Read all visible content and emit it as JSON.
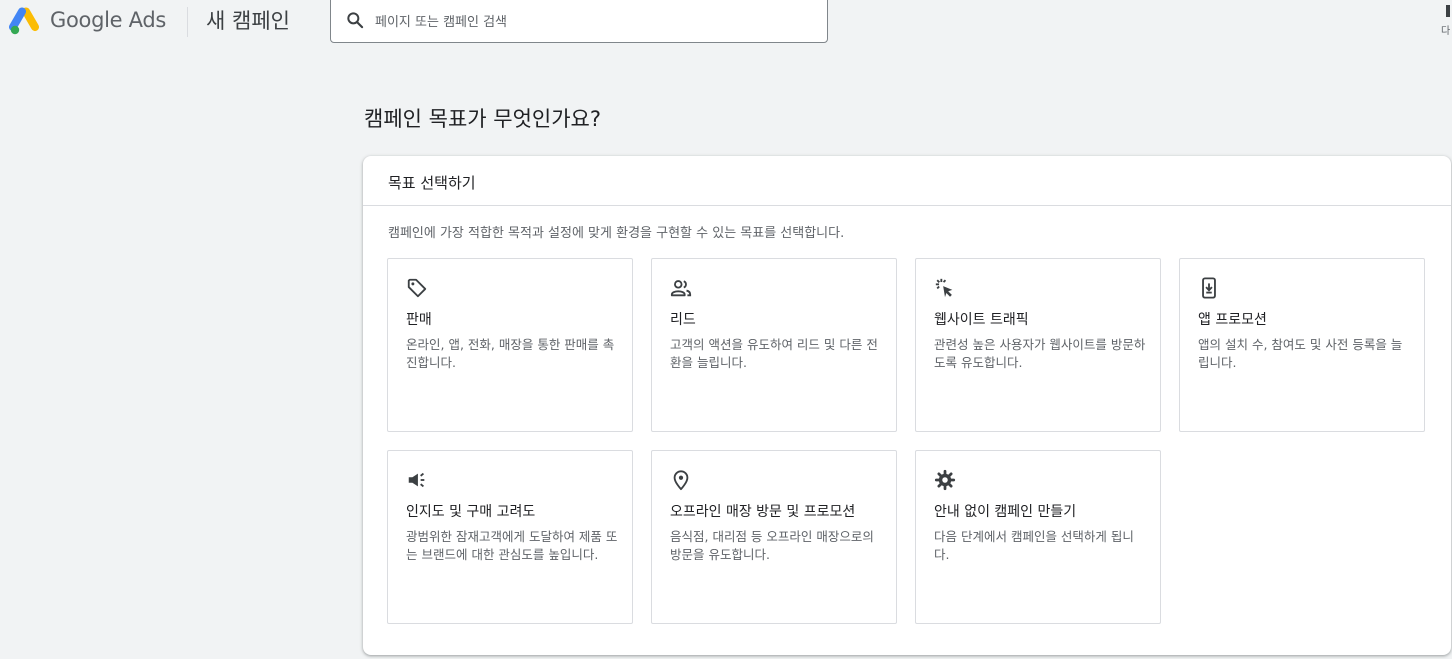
{
  "header": {
    "brand": "Google Ads",
    "page_name": "새 캠페인",
    "search_placeholder": "페이지 또는 캠페인 검색",
    "corner_text": "다"
  },
  "main": {
    "heading": "캠페인 목표가 무엇인가요?",
    "panel": {
      "title": "목표 선택하기",
      "description": "캠페인에 가장 적합한 목적과 설정에 맞게 환경을 구현할 수 있는 목표를 선택합니다.",
      "goals": [
        {
          "icon": "tag-icon",
          "title": "판매",
          "desc": "온라인, 앱, 전화, 매장을 통한 판매를 촉진합니다."
        },
        {
          "icon": "people-icon",
          "title": "리드",
          "desc": "고객의 액션을 유도하여 리드 및 다른 전환을 늘립니다."
        },
        {
          "icon": "cursor-click-icon",
          "title": "웹사이트 트래픽",
          "desc": "관련성 높은 사용자가 웹사이트를 방문하도록 유도합니다."
        },
        {
          "icon": "phone-download-icon",
          "title": "앱 프로모션",
          "desc": "앱의 설치 수, 참여도 및 사전 등록을 늘립니다."
        },
        {
          "icon": "megaphone-icon",
          "title": "인지도 및 구매 고려도",
          "desc": "광범위한 잠재고객에게 도달하여 제품 또는 브랜드에 대한 관심도를 높입니다."
        },
        {
          "icon": "location-pin-icon",
          "title": "오프라인 매장 방문 및 프로모션",
          "desc": "음식점, 대리점 등 오프라인 매장으로의 방문을 유도합니다."
        },
        {
          "icon": "gear-icon",
          "title": "안내 없이 캠페인 만들기",
          "desc": "다음 단계에서 캠페인을 선택하게 됩니다."
        }
      ]
    }
  },
  "colors": {
    "background": "#f1f3f4",
    "logo_blue": "#4285f4",
    "logo_yellow": "#fbbc04",
    "logo_green": "#34a853",
    "text": "#202124",
    "secondary_text": "#5f6368"
  }
}
